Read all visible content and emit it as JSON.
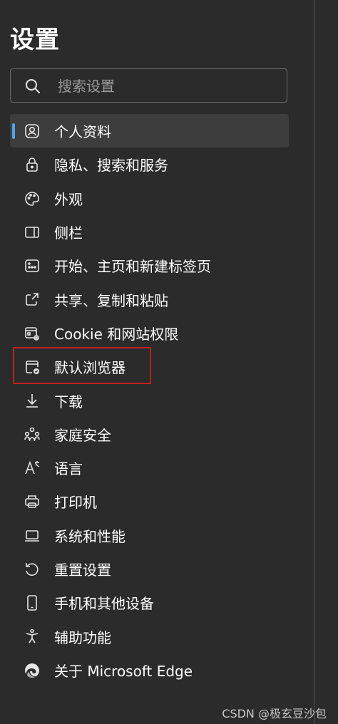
{
  "header": {
    "title": "设置"
  },
  "search": {
    "placeholder": "搜索设置"
  },
  "nav": {
    "items": [
      {
        "label": "个人资料",
        "icon": "profile-icon",
        "active": true
      },
      {
        "label": "隐私、搜索和服务",
        "icon": "lock-icon"
      },
      {
        "label": "外观",
        "icon": "palette-icon"
      },
      {
        "label": "侧栏",
        "icon": "sidebar-icon"
      },
      {
        "label": "开始、主页和新建标签页",
        "icon": "home-tab-icon"
      },
      {
        "label": "共享、复制和粘贴",
        "icon": "share-icon"
      },
      {
        "label": "Cookie 和网站权限",
        "icon": "site-permissions-icon"
      },
      {
        "label": "默认浏览器",
        "icon": "default-browser-icon"
      },
      {
        "label": "下载",
        "icon": "download-icon"
      },
      {
        "label": "家庭安全",
        "icon": "family-icon"
      },
      {
        "label": "语言",
        "icon": "language-icon"
      },
      {
        "label": "打印机",
        "icon": "printer-icon"
      },
      {
        "label": "系统和性能",
        "icon": "laptop-icon"
      },
      {
        "label": "重置设置",
        "icon": "reset-icon"
      },
      {
        "label": "手机和其他设备",
        "icon": "phone-icon"
      },
      {
        "label": "辅助功能",
        "icon": "accessibility-icon"
      },
      {
        "label": "关于 Microsoft Edge",
        "icon": "edge-logo-icon"
      }
    ]
  },
  "watermark": "CSDN @极玄豆沙包",
  "colors": {
    "background": "#2b2b2b",
    "active_bg": "#3d3d3d",
    "accent": "#4ea3f1",
    "highlight_border": "#c0201e"
  }
}
